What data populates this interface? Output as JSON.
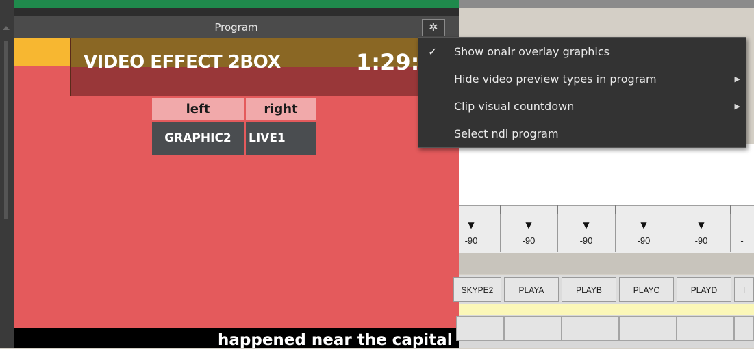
{
  "program_panel": {
    "title": "Program",
    "gear_icon": "gear-icon",
    "effect_title": "VIDEO EFFECT 2BOX",
    "time": "1:29:",
    "boxes": [
      {
        "label": "left",
        "source": "GRAPHIC2"
      },
      {
        "label": "right",
        "source": "LIVE1"
      }
    ],
    "ticker_text": "happened near the capital"
  },
  "context_menu": {
    "items": [
      {
        "label": "Show onair overlay graphics",
        "checked": true,
        "submenu": false
      },
      {
        "label": "Hide video preview types in program",
        "checked": false,
        "submenu": true
      },
      {
        "label": "Clip visual countdown",
        "checked": false,
        "submenu": true
      },
      {
        "label": "Select ndi program",
        "checked": false,
        "submenu": false
      }
    ],
    "check_glyph": "✓",
    "submenu_glyph": "▶"
  },
  "mixer": {
    "dropdown_glyph": "▼",
    "levels": [
      "-90",
      "-90",
      "-90",
      "-90",
      "-90",
      "-"
    ]
  },
  "channels": {
    "buttons": [
      "SKYPE2",
      "PLAYA",
      "PLAYB",
      "PLAYC",
      "PLAYD",
      "I"
    ]
  },
  "colors": {
    "program_red": "#e45a5c",
    "accent_yellow": "#f7b731",
    "accent_green": "#1f8a4c",
    "menu_bg": "#333333"
  }
}
